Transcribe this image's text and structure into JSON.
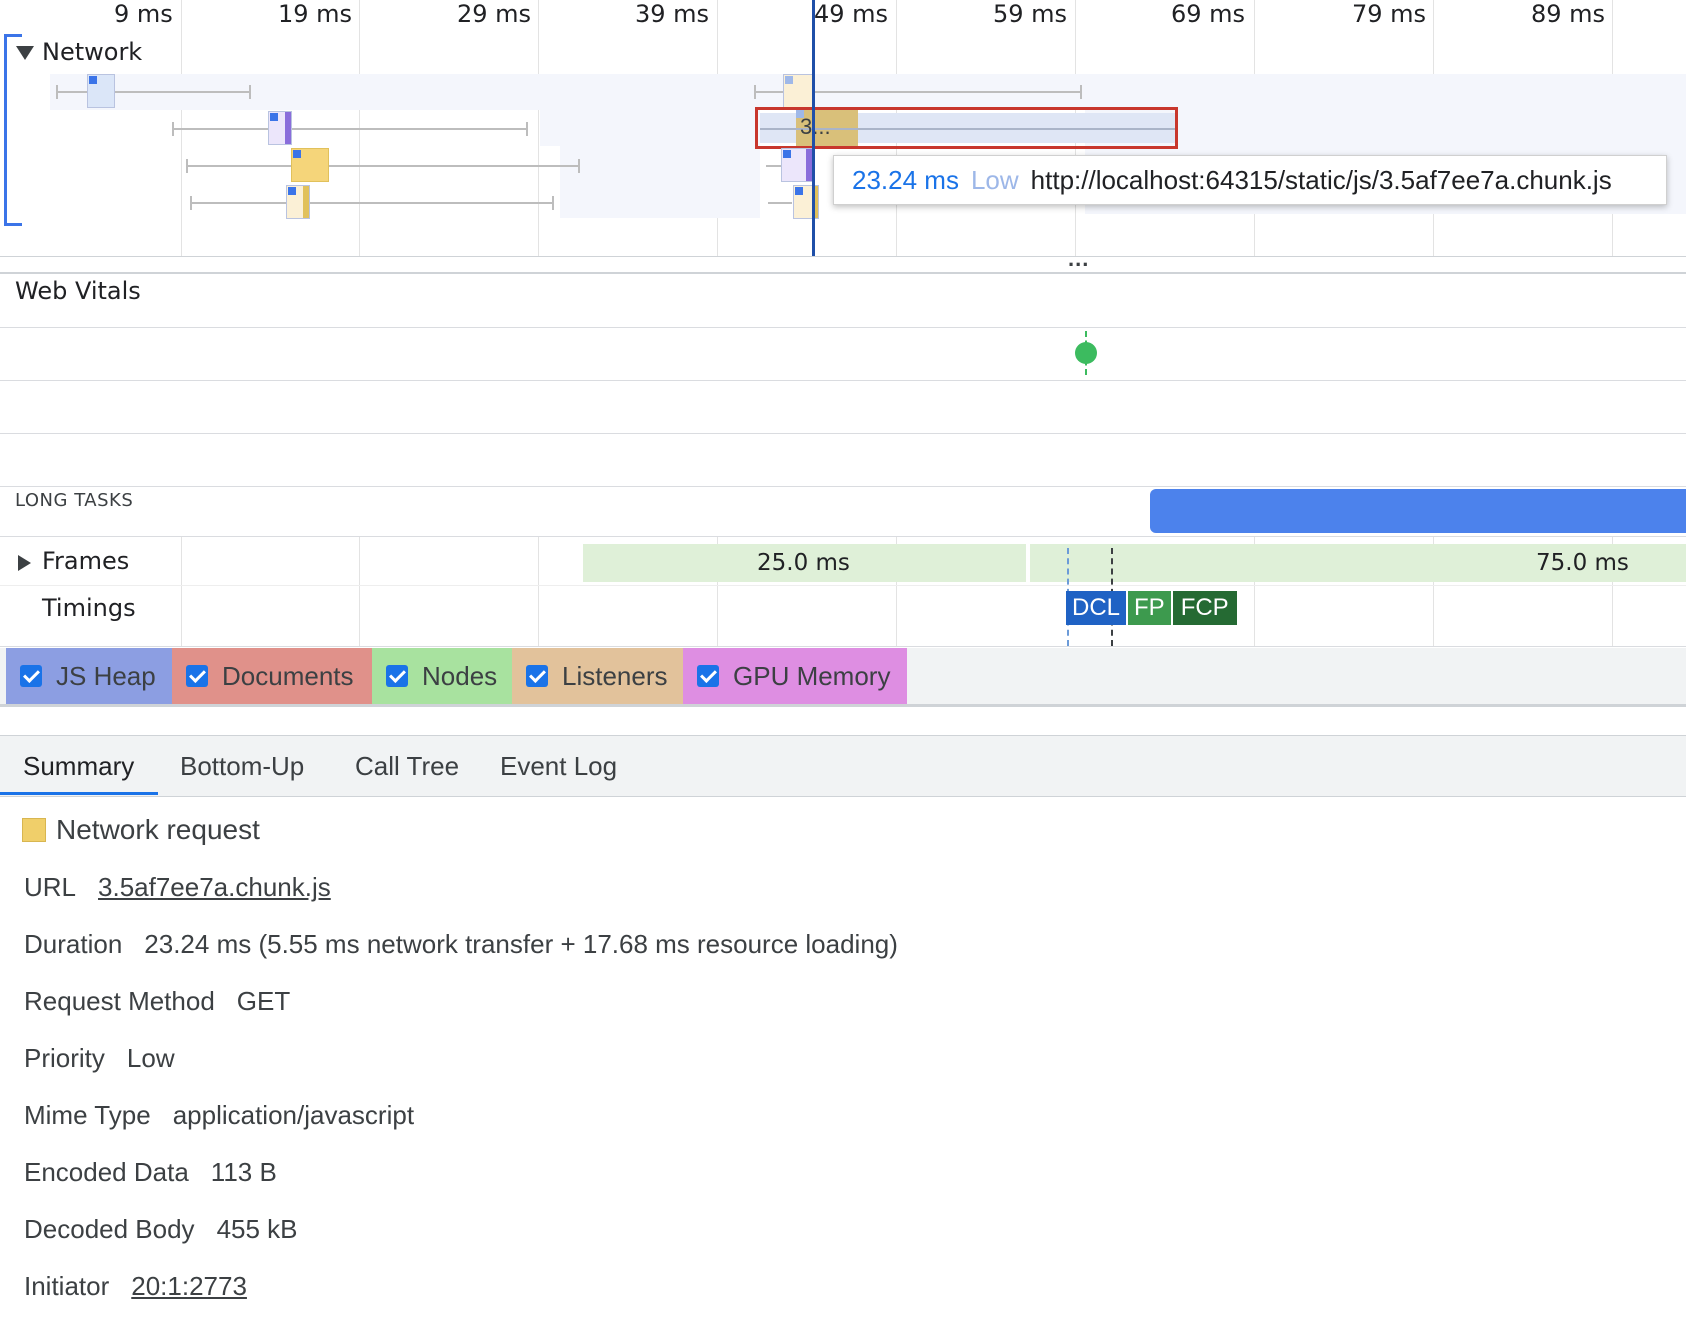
{
  "ruler": {
    "ticks": [
      "9 ms",
      "19 ms",
      "29 ms",
      "39 ms",
      "49 ms",
      "59 ms",
      "69 ms",
      "79 ms",
      "89 ms"
    ]
  },
  "network": {
    "label": "Network",
    "selected_request_label": "3...",
    "tooltip": {
      "duration": "23.24 ms",
      "priority": "Low",
      "url": "http://localhost:64315/static/js/3.5af7ee7a.chunk.js"
    },
    "colors": {
      "script": "#f5d57a",
      "document": "#dbe6f8",
      "stylesheet": "#e6ddfa",
      "selection": "#c8372d"
    }
  },
  "more_indicator": "...",
  "web_vitals": {
    "label": "Web Vitals",
    "marker_color": "#3cbb5f"
  },
  "long_tasks": {
    "label": "LONG TASKS",
    "bar_color": "#4c82ec"
  },
  "frames": {
    "label": "Frames",
    "values": [
      "25.0 ms",
      "75.0 ms"
    ]
  },
  "timings": {
    "label": "Timings",
    "markers": [
      {
        "label": "DCL",
        "color": "#1f62c4"
      },
      {
        "label": "FP",
        "color": "#3d9a4e"
      },
      {
        "label": "FCP",
        "color": "#256a33"
      }
    ]
  },
  "counters": [
    {
      "label": "JS Heap",
      "color": "#8c9ee2"
    },
    {
      "label": "Documents",
      "color": "#e0918a"
    },
    {
      "label": "Nodes",
      "color": "#a8e29f"
    },
    {
      "label": "Listeners",
      "color": "#e2c29b"
    },
    {
      "label": "GPU Memory",
      "color": "#de8ee2"
    }
  ],
  "tabs": [
    {
      "label": "Summary",
      "active": true
    },
    {
      "label": "Bottom-Up",
      "active": false
    },
    {
      "label": "Call Tree",
      "active": false
    },
    {
      "label": "Event Log",
      "active": false
    }
  ],
  "summary": {
    "title": "Network request",
    "swatch_color": "#f0cf6a",
    "rows": [
      {
        "key": "URL",
        "value": "3.5af7ee7a.chunk.js",
        "link": true
      },
      {
        "key": "Duration",
        "value": "23.24 ms (5.55 ms network transfer + 17.68 ms resource loading)",
        "link": false
      },
      {
        "key": "Request Method",
        "value": "GET",
        "link": false
      },
      {
        "key": "Priority",
        "value": "Low",
        "link": false
      },
      {
        "key": "Mime Type",
        "value": "application/javascript",
        "link": false
      },
      {
        "key": "Encoded Data",
        "value": "113 B",
        "link": false
      },
      {
        "key": "Decoded Body",
        "value": "455 kB",
        "link": false
      },
      {
        "key": "Initiator",
        "value": "20:1:2773",
        "link": true
      }
    ]
  }
}
